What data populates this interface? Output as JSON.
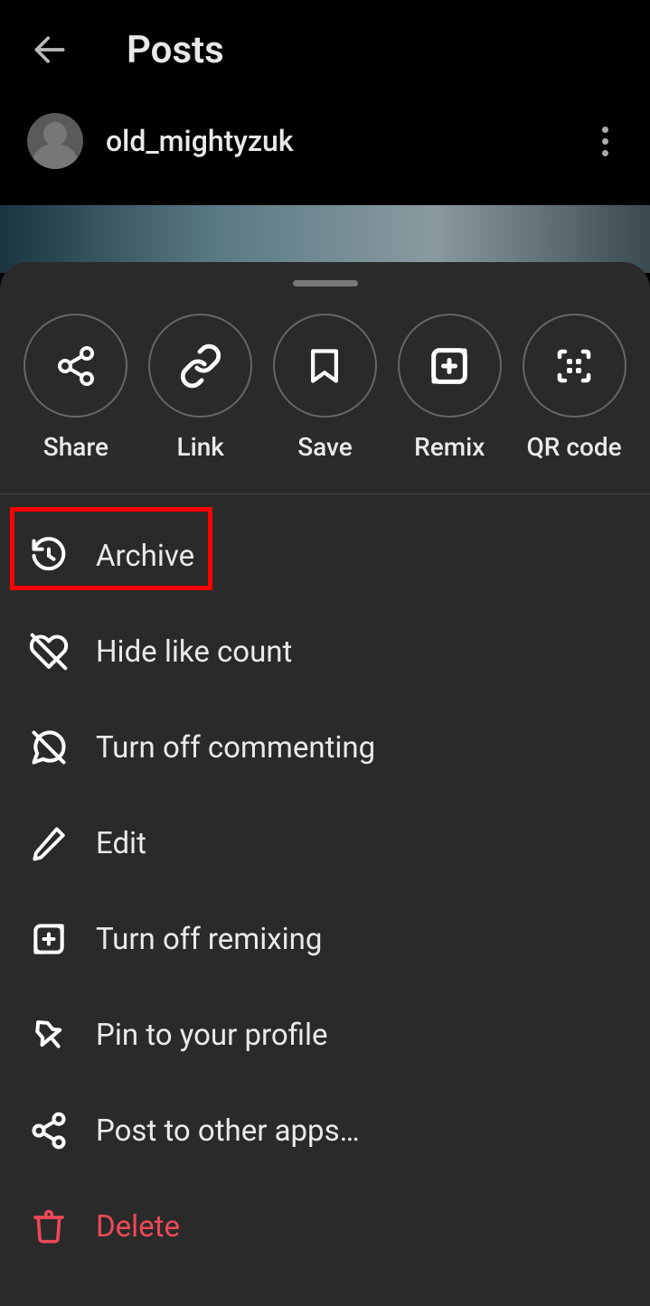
{
  "header": {
    "title": "Posts"
  },
  "user": {
    "name": "old_mightyzuk"
  },
  "actions": {
    "share": "Share",
    "link": "Link",
    "save": "Save",
    "remix": "Remix",
    "qrcode": "QR code"
  },
  "menu": {
    "archive": "Archive",
    "hide_likes": "Hide like count",
    "turn_off_comments": "Turn off commenting",
    "edit": "Edit",
    "turn_off_remix": "Turn off remixing",
    "pin": "Pin to your profile",
    "post_other": "Post to other apps…",
    "delete": "Delete"
  }
}
